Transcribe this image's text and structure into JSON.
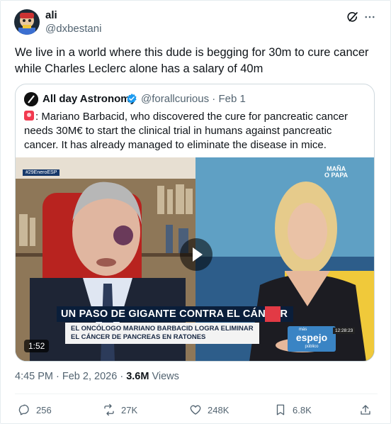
{
  "author": {
    "name": "ali",
    "handle": "@dxbestani"
  },
  "tweet_text": "We live in a world where this dude is begging for 30m to cure cancer while Charles Leclerc alone has a salary of 40m",
  "quoted": {
    "name": "All day Astronomy",
    "handle": "@forallcurious",
    "separator": "·",
    "date": "Feb 1",
    "text": ": Mariano Barbacid, who discovered the cure for pancreatic cancer needs 30M€ to start the clinical trial in humans against pancreatic cancer. It has already managed to eliminate the disease in mice.",
    "video": {
      "duration": "1:52",
      "headline": "UN PASO DE GIGANTE CONTRA EL CÁNCER",
      "subhead_line1": "EL ONCÓLOGO MARIANO BARBACID LOGRA ELIMINAR",
      "subhead_line2": "EL CÁNCER DE PANCREAS EN RATONES",
      "corner_tag": "#29EneroESP",
      "logo_line1": "MAÑA",
      "logo_line2": "O PAPA",
      "brand_top": "más",
      "brand": "espejo",
      "brand_foot": "público",
      "clock": "12:28:23"
    }
  },
  "meta": {
    "time": "4:45 PM",
    "sep": " · ",
    "date": "Feb 2, 2026",
    "sep2": " · ",
    "views_count": "3.6M",
    "views_label": " Views"
  },
  "actions": {
    "replies": "256",
    "reposts": "27K",
    "likes": "248K",
    "bookmarks": "6.8K"
  },
  "colors": {
    "verified": "#1d9bf0",
    "text_secondary": "#536471",
    "border": "#cfd9de",
    "headline_bg": "#0a1e3a",
    "headline_accent": "#e23a45"
  }
}
